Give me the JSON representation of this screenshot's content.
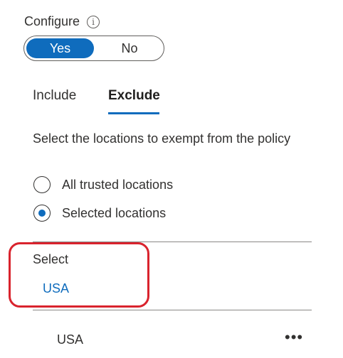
{
  "configure": {
    "label": "Configure",
    "info_icon": "info-icon",
    "toggle": {
      "yes_label": "Yes",
      "no_label": "No",
      "selected": "Yes"
    }
  },
  "tabs": [
    {
      "label": "Include",
      "active": false
    },
    {
      "label": "Exclude",
      "active": true
    }
  ],
  "description": "Select the locations to exempt from the policy",
  "radio_options": [
    {
      "label": "All trusted locations",
      "selected": false
    },
    {
      "label": "Selected locations",
      "selected": true
    }
  ],
  "select": {
    "label": "Select",
    "value": "USA"
  },
  "selected_list": [
    {
      "label": "USA",
      "more_icon": "more-horizontal-icon"
    }
  ],
  "colors": {
    "accent": "#0f6cbd",
    "highlight": "#d9232d"
  }
}
